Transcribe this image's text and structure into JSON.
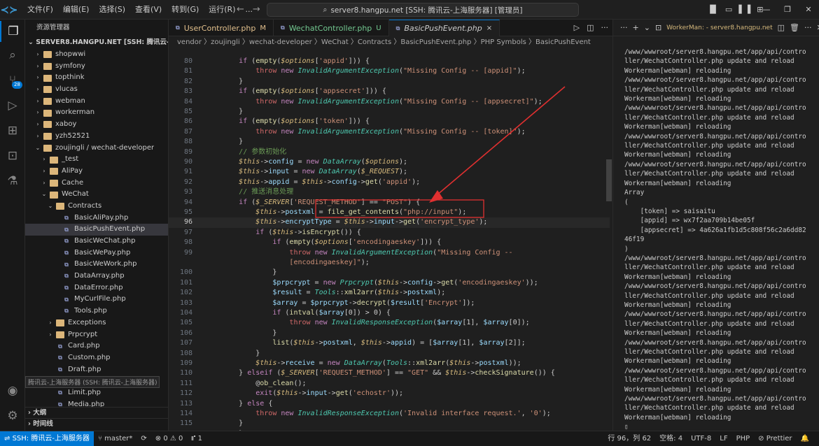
{
  "titlebar": {
    "menu": [
      "文件(F)",
      "编辑(E)",
      "选择(S)",
      "查看(V)",
      "转到(G)",
      "运行(R)",
      "..."
    ],
    "command_center": "server8.hangpu.net [SSH: 腾讯云-上海服务器] [管理员]"
  },
  "sidebar": {
    "title": "资源管理器",
    "root": "SERVER8.HANGPU.NET [SSH: 腾讯云-上海服务...",
    "items": [
      {
        "label": "shopwwi",
        "type": "folder",
        "depth": 1,
        "state": "closed"
      },
      {
        "label": "symfony",
        "type": "folder",
        "depth": 1,
        "state": "closed"
      },
      {
        "label": "topthink",
        "type": "folder",
        "depth": 1,
        "state": "closed"
      },
      {
        "label": "vlucas",
        "type": "folder",
        "depth": 1,
        "state": "closed"
      },
      {
        "label": "webman",
        "type": "folder",
        "depth": 1,
        "state": "closed"
      },
      {
        "label": "workerman",
        "type": "folder",
        "depth": 1,
        "state": "closed"
      },
      {
        "label": "xaboy",
        "type": "folder",
        "depth": 1,
        "state": "closed"
      },
      {
        "label": "yzh52521",
        "type": "folder",
        "depth": 1,
        "state": "closed"
      },
      {
        "label": "zoujingli / wechat-developer",
        "type": "folder",
        "depth": 1,
        "state": "open"
      },
      {
        "label": "_test",
        "type": "folder",
        "depth": 2,
        "state": "closed"
      },
      {
        "label": "AliPay",
        "type": "folder",
        "depth": 2,
        "state": "closed"
      },
      {
        "label": "Cache",
        "type": "folder",
        "depth": 2,
        "state": "closed"
      },
      {
        "label": "WeChat",
        "type": "folder",
        "depth": 2,
        "state": "open"
      },
      {
        "label": "Contracts",
        "type": "folder",
        "depth": 3,
        "state": "open"
      },
      {
        "label": "BasicAliPay.php",
        "type": "php",
        "depth": 4
      },
      {
        "label": "BasicPushEvent.php",
        "type": "php",
        "depth": 4,
        "selected": true
      },
      {
        "label": "BasicWeChat.php",
        "type": "php",
        "depth": 4
      },
      {
        "label": "BasicWePay.php",
        "type": "php",
        "depth": 4
      },
      {
        "label": "BasicWeWork.php",
        "type": "php",
        "depth": 4
      },
      {
        "label": "DataArray.php",
        "type": "php",
        "depth": 4
      },
      {
        "label": "DataError.php",
        "type": "php",
        "depth": 4
      },
      {
        "label": "MyCurlFile.php",
        "type": "php",
        "depth": 4
      },
      {
        "label": "Tools.php",
        "type": "php",
        "depth": 4
      },
      {
        "label": "Exceptions",
        "type": "folder",
        "depth": 3,
        "state": "closed"
      },
      {
        "label": "Prpcrypt",
        "type": "folder",
        "depth": 3,
        "state": "closed"
      },
      {
        "label": "Card.php",
        "type": "php",
        "depth": 3
      },
      {
        "label": "Custom.php",
        "type": "php",
        "depth": 3
      },
      {
        "label": "Draft.php",
        "type": "php",
        "depth": 3
      },
      {
        "label": "Freepublish.php",
        "type": "php",
        "depth": 3
      },
      {
        "label": "Limit.php",
        "type": "php",
        "depth": 3
      },
      {
        "label": "Media.php",
        "type": "php",
        "depth": 3
      }
    ],
    "tooltip": "腾讯云-上海服务器 (SSH: 腾讯云-上海服务器)",
    "outline": "大纲",
    "timeline": "时间线"
  },
  "editor": {
    "tabs": [
      {
        "label": "UserController.php",
        "mod": "M",
        "color": "#e2c08d"
      },
      {
        "label": "WechatController.php",
        "mod": "U",
        "color": "#73c991"
      },
      {
        "label": "BasicPushEvent.php",
        "mod": "×",
        "color": "#cccccc",
        "active": true
      }
    ],
    "breadcrumb": "vendor 〉zoujingli 〉wechat-developer 〉WeChat 〉Contracts 〉BasicPushEvent.php 〉PHP Symbols 〉BasicPushEvent",
    "current_line": 96
  },
  "terminal": {
    "name": "WorkerMan: - server8.hangpu.net",
    "lines": [
      "/www/wwwroot/server8.hangpu.net/app/api/contro",
      "ller/WechatController.php update and reload",
      "Workerman[webman] reloading",
      "/www/wwwroot/server8.hangpu.net/app/api/contro",
      "ller/WechatController.php update and reload",
      "Workerman[webman] reloading",
      "/www/wwwroot/server8.hangpu.net/app/api/contro",
      "ller/WechatController.php update and reload",
      "Workerman[webman] reloading",
      "/www/wwwroot/server8.hangpu.net/app/api/contro",
      "ller/WechatController.php update and reload",
      "Workerman[webman] reloading",
      "/www/wwwroot/server8.hangpu.net/app/api/contro",
      "ller/WechatController.php update and reload",
      "Workerman[webman] reloading",
      "Array",
      "(",
      "    [token] => saisaitu",
      "    [appid] => wx7f2aa709b14be05f",
      "    [appsecret] => 4a626a1fb1d5c808f56c2a6dd82",
      "46f19",
      ")",
      "/www/wwwroot/server8.hangpu.net/app/api/contro",
      "ller/WechatController.php update and reload",
      "Workerman[webman] reloading",
      "/www/wwwroot/server8.hangpu.net/app/api/contro",
      "ller/WechatController.php update and reload",
      "Workerman[webman] reloading",
      "/www/wwwroot/server8.hangpu.net/app/api/contro",
      "ller/WechatController.php update and reload",
      "Workerman[webman] reloading",
      "/www/wwwroot/server8.hangpu.net/app/api/contro",
      "ller/WechatController.php update and reload",
      "Workerman[webman] reloading",
      "/www/wwwroot/server8.hangpu.net/app/api/contro",
      "ller/WechatController.php update and reload",
      "Workerman[webman] reloading",
      "/www/wwwroot/server8.hangpu.net/app/api/contro",
      "ller/WechatController.php update and reload",
      "Workerman[webman] reloading",
      "▯"
    ]
  },
  "statusbar": {
    "remote": "SSH: 腾讯云-上海服务器",
    "branch": "master*",
    "problems": "⊗ 0 ⚠ 0",
    "ports": "1",
    "position": "行 96，列 62",
    "spaces": "空格: 4",
    "encoding": "UTF-8",
    "eol": "LF",
    "language": "PHP",
    "formatter": "Prettier"
  },
  "colors": {
    "accent": "#0078d4",
    "annotation": "#e03030"
  },
  "icons": [
    "files-icon",
    "search-icon",
    "source-control-icon",
    "run-debug-icon",
    "extensions-icon",
    "remote-explorer-icon",
    "testing-icon",
    "account-icon",
    "settings-gear-icon"
  ],
  "code_lines": [
    {
      "n": 80,
      "html": "<span class=\"kw\">if</span> (<span class=\"fn\">empty</span>(<span class=\"var\">$options</span>[<span class=\"str\">'appid'</span>])) {"
    },
    {
      "n": 81,
      "html": "    <span class=\"k2\">throw</span> <span class=\"kw\">new</span> <span class=\"cls\">InvalidArgumentException</span>(<span class=\"str\">\"Missing Config -- [appid]\"</span>);"
    },
    {
      "n": 82,
      "html": "}"
    },
    {
      "n": 83,
      "html": "<span class=\"kw\">if</span> (<span class=\"fn\">empty</span>(<span class=\"var\">$options</span>[<span class=\"str\">'appsecret'</span>])) {"
    },
    {
      "n": 84,
      "html": "    <span class=\"k2\">throw</span> <span class=\"kw\">new</span> <span class=\"cls\">InvalidArgumentException</span>(<span class=\"str\">\"Missing Config -- [appsecret]\"</span>);"
    },
    {
      "n": 85,
      "html": "}"
    },
    {
      "n": 86,
      "html": "<span class=\"kw\">if</span> (<span class=\"fn\">empty</span>(<span class=\"var\">$options</span>[<span class=\"str\">'token'</span>])) {"
    },
    {
      "n": 87,
      "html": "    <span class=\"k2\">throw</span> <span class=\"kw\">new</span> <span class=\"cls\">InvalidArgumentException</span>(<span class=\"str\">\"Missing Config -- [token]\"</span>);"
    },
    {
      "n": 88,
      "html": "}"
    },
    {
      "n": 89,
      "html": "<span class=\"cm\">// 参数初始化</span>"
    },
    {
      "n": 90,
      "html": "<span class=\"var\">$this</span>-&gt;<span class=\"prop\">config</span> = <span class=\"kw\">new</span> <span class=\"cls\">DataArray</span>(<span class=\"var\">$options</span>);"
    },
    {
      "n": 91,
      "html": "<span class=\"var\">$this</span>-&gt;<span class=\"prop\">input</span> = <span class=\"kw\">new</span> <span class=\"cls\">DataArray</span>(<span class=\"var\">$_REQUEST</span>);"
    },
    {
      "n": 92,
      "html": "<span class=\"var\">$this</span>-&gt;<span class=\"prop\">appid</span> = <span class=\"var\">$this</span>-&gt;<span class=\"prop\">config</span>-&gt;<span class=\"fn\">get</span>(<span class=\"str\">'appid'</span>);"
    },
    {
      "n": 93,
      "html": "<span class=\"cm\">// 推送消息处理</span>"
    },
    {
      "n": 94,
      "html": "<span class=\"kw\">if</span> (<span class=\"var\">$_SERVER</span>[<span class=\"str\">'REQUEST_METHOD'</span>] == <span class=\"str\">\"POST\"</span>) {"
    },
    {
      "n": 95,
      "html": "    <span class=\"var\">$this</span>-&gt;<span class=\"prop\">postxml</span> = <span class=\"fn\">file_get_contents</span>(<span class=\"str\">\"php://input\"</span>);"
    },
    {
      "n": 96,
      "html": "    <span class=\"var\">$this</span>-&gt;<span class=\"prop\">encryptType</span> = <span class=\"var\">$this</span>-&gt;<span class=\"prop\">input</span>-&gt;<span class=\"fn\">get</span>(<span class=\"str\">'encrypt_type'</span>);"
    },
    {
      "n": 97,
      "html": "    <span class=\"kw\">if</span> (<span class=\"var\">$this</span>-&gt;<span class=\"fn\">isEncrypt</span>()) {"
    },
    {
      "n": 98,
      "html": "        <span class=\"kw\">if</span> (<span class=\"fn\">empty</span>(<span class=\"var\">$options</span>[<span class=\"str\">'encodingaeskey'</span>])) {"
    },
    {
      "n": 99,
      "html": "            <span class=\"k2\">throw</span> <span class=\"kw\">new</span> <span class=\"cls\">InvalidArgumentException</span>(<span class=\"str\">\"Missing Config --</span>"
    },
    {
      "n": null,
      "html": "            <span class=\"str\">[encodingaeskey]\"</span>);"
    },
    {
      "n": 100,
      "html": "        }"
    },
    {
      "n": 101,
      "html": "        <span class=\"prop\">$prpcrypt</span> = <span class=\"kw\">new</span> <span class=\"cls\">Prpcrypt</span>(<span class=\"var\">$this</span>-&gt;<span class=\"prop\">config</span>-&gt;<span class=\"fn\">get</span>(<span class=\"str\">'encodingaeskey'</span>));"
    },
    {
      "n": 102,
      "html": "        <span class=\"prop\">$result</span> = <span class=\"cls\">Tools</span>::<span class=\"fn\">xml2arr</span>(<span class=\"var\">$this</span>-&gt;<span class=\"prop\">postxml</span>);"
    },
    {
      "n": 103,
      "html": "        <span class=\"prop\">$array</span> = <span class=\"prop\">$prpcrypt</span>-&gt;<span class=\"fn\">decrypt</span>(<span class=\"prop\">$result</span>[<span class=\"str\">'Encrypt'</span>]);"
    },
    {
      "n": 104,
      "html": "        <span class=\"kw\">if</span> (<span class=\"fn\">intval</span>(<span class=\"prop\">$array</span>[0]) &gt; 0) {"
    },
    {
      "n": 105,
      "html": "            <span class=\"k2\">throw</span> <span class=\"kw\">new</span> <span class=\"cls\">InvalidResponseException</span>(<span class=\"prop\">$array</span>[1], <span class=\"prop\">$array</span>[0]);"
    },
    {
      "n": 106,
      "html": "        }"
    },
    {
      "n": 107,
      "html": "        <span class=\"fn\">list</span>(<span class=\"var\">$this</span>-&gt;<span class=\"prop\">postxml</span>, <span class=\"var\">$this</span>-&gt;<span class=\"prop\">appid</span>) = [<span class=\"prop\">$array</span>[1], <span class=\"prop\">$array</span>[2]];"
    },
    {
      "n": 108,
      "html": "    }"
    },
    {
      "n": 109,
      "html": "    <span class=\"var\">$this</span>-&gt;<span class=\"prop\">receive</span> = <span class=\"kw\">new</span> <span class=\"cls\">DataArray</span>(<span class=\"cls\">Tools</span>::<span class=\"fn\">xml2arr</span>(<span class=\"var\">$this</span>-&gt;<span class=\"prop\">postxml</span>));"
    },
    {
      "n": 110,
      "html": "} <span class=\"kw\">elseif</span> (<span class=\"var\">$_SERVER</span>[<span class=\"str\">'REQUEST_METHOD'</span>] == <span class=\"str\">\"GET\"</span> &amp;&amp; <span class=\"var\">$this</span>-&gt;<span class=\"fn\">checkSignature</span>()) {"
    },
    {
      "n": 111,
      "html": "    @<span class=\"fn\">ob_clean</span>();"
    },
    {
      "n": 112,
      "html": "    <span class=\"kw\">exit</span>(<span class=\"var\">$this</span>-&gt;<span class=\"prop\">input</span>-&gt;<span class=\"fn\">get</span>(<span class=\"str\">'echostr'</span>));"
    },
    {
      "n": 113,
      "html": "} <span class=\"kw\">else</span> {"
    },
    {
      "n": 114,
      "html": "    <span class=\"k2\">throw</span> <span class=\"kw\">new</span> <span class=\"cls\">InvalidResponseException</span>(<span class=\"str\">'Invalid interface request.'</span>, <span class=\"str\">'0'</span>);"
    },
    {
      "n": 115,
      "html": "}"
    },
    {
      "n": 116,
      "html": "}"
    }
  ]
}
